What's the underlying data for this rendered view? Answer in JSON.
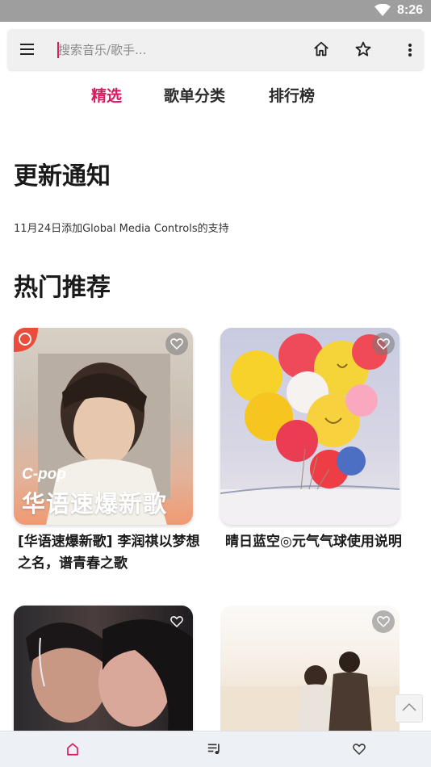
{
  "status_bar": {
    "time": "8:26",
    "icons": [
      "wifi-icon"
    ]
  },
  "search": {
    "placeholder": "搜索音乐/歌手...",
    "value": ""
  },
  "toolbar": {
    "icons": [
      "menu-icon",
      "home-icon",
      "star-icon",
      "more-vert-icon"
    ]
  },
  "tabs": [
    {
      "label": "精选",
      "active": true
    },
    {
      "label": "歌单分类",
      "active": false
    },
    {
      "label": "排行榜",
      "active": false
    }
  ],
  "update_section": {
    "heading": "更新通知",
    "text": "11月24日添加Global Media Controls的支持"
  },
  "recommend_section": {
    "heading": "热门推荐",
    "cards": [
      {
        "title": "[华语速爆新歌] 李润祺以梦想之名，谱青春之歌",
        "overlay_tag": "C-pop",
        "overlay_title": "华语速爆新歌"
      },
      {
        "title": "晴日蓝空◎元气气球使用说明"
      },
      {
        "title": ""
      },
      {
        "title": ""
      }
    ]
  },
  "bottom_nav": [
    {
      "icon": "home-icon",
      "active": true
    },
    {
      "icon": "playlist-icon",
      "active": false
    },
    {
      "icon": "heart-icon",
      "active": false
    }
  ],
  "colors": {
    "accent": "#d81b60",
    "status_bar": "#9e9e9e",
    "bottom_nav": "#edf0f5"
  }
}
